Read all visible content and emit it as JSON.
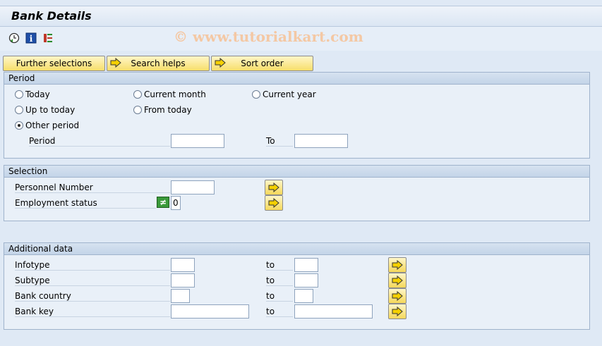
{
  "window": {
    "title": "Bank Details"
  },
  "toolbar": {
    "icons": [
      "execute-clock-icon",
      "info-icon",
      "selection-options-icon"
    ],
    "watermark": "© www.tutorialkart.com"
  },
  "tabs_buttons": {
    "further": "Further selections",
    "search": "Search helps",
    "sort": "Sort order"
  },
  "period": {
    "title": "Period",
    "options": {
      "today": "Today",
      "current_month": "Current month",
      "current_year": "Current year",
      "up_to_today": "Up to today",
      "from_today": "From today",
      "other_period": "Other period"
    },
    "selected": "other_period",
    "period_label": "Period",
    "to_label": "To",
    "from_value": "",
    "to_value": ""
  },
  "selection": {
    "title": "Selection",
    "personnel_label": "Personnel Number",
    "personnel_value": "",
    "employment_label": "Employment status",
    "employment_value": "0",
    "employment_option": "≠"
  },
  "additional": {
    "title": "Additional data",
    "rows": [
      {
        "label": "Infotype",
        "to": "to",
        "from_value": "",
        "to_value": ""
      },
      {
        "label": "Subtype",
        "to": "to",
        "from_value": "",
        "to_value": ""
      },
      {
        "label": "Bank country",
        "to": "to",
        "from_value": "",
        "to_value": ""
      },
      {
        "label": "Bank key",
        "to": "to",
        "from_value": "",
        "to_value": ""
      }
    ]
  },
  "colors": {
    "background": "#dfe9f5",
    "button_yellow": "#f7de6a",
    "group_border": "#9fb3cc"
  }
}
